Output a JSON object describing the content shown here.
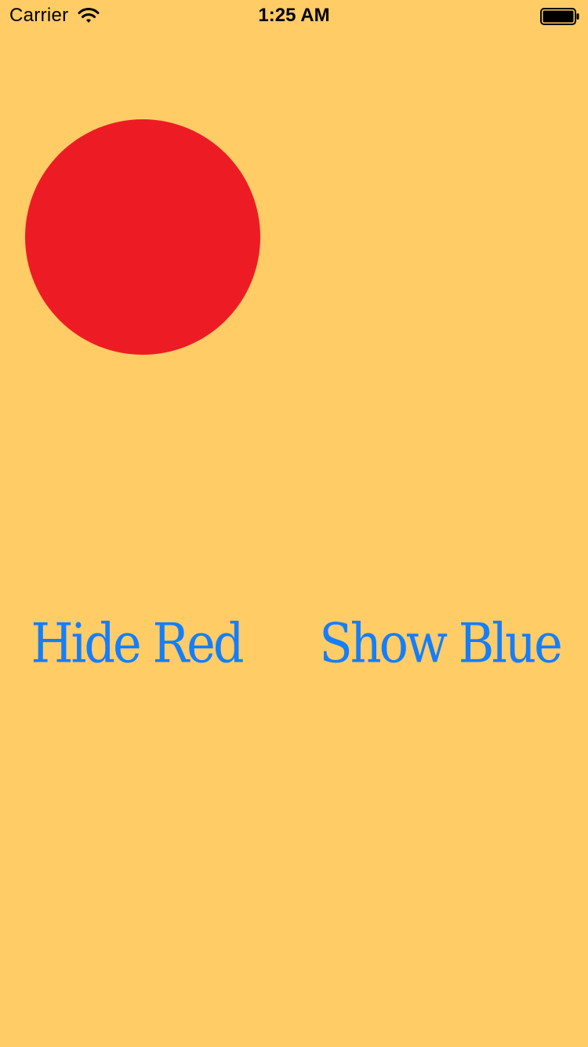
{
  "status_bar": {
    "carrier": "Carrier",
    "time": "1:25 AM",
    "wifi_icon": "wifi-icon",
    "battery_icon": "battery-full-icon"
  },
  "main": {
    "background_color": "#FFCC66",
    "circle_color": "#ED1C24",
    "button_color": "#147EFB",
    "hide_red_label": "Hide Red",
    "show_blue_label": "Show Blue"
  }
}
